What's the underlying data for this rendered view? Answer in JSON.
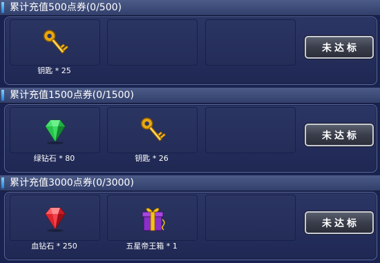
{
  "tiers": [
    {
      "title": "累计充值500点券(0/500)",
      "button_label": "未达标",
      "rewards": [
        {
          "icon": "key-icon",
          "label": "钥匙 * 25"
        },
        {
          "icon": "",
          "label": ""
        },
        {
          "icon": "",
          "label": ""
        }
      ]
    },
    {
      "title": "累计充值1500点券(0/1500)",
      "button_label": "未达标",
      "rewards": [
        {
          "icon": "green-diamond-icon",
          "label": "绿钻石 * 80"
        },
        {
          "icon": "key-icon",
          "label": "钥匙 * 26"
        },
        {
          "icon": "",
          "label": ""
        }
      ]
    },
    {
      "title": "累计充值3000点券(0/3000)",
      "button_label": "未达标",
      "rewards": [
        {
          "icon": "red-diamond-icon",
          "label": "血钻石 * 250"
        },
        {
          "icon": "gift-box-icon",
          "label": "五星帝王箱 * 1"
        },
        {
          "icon": "",
          "label": ""
        }
      ]
    }
  ],
  "colors": {
    "background": "#1a2350",
    "header": "#3d4a78",
    "panel_border": "#5a6a9a",
    "key_gold": "#f2b51c",
    "green_gem": "#27c44b",
    "red_gem": "#e0232d",
    "gift_purple": "#8a2fc9"
  }
}
